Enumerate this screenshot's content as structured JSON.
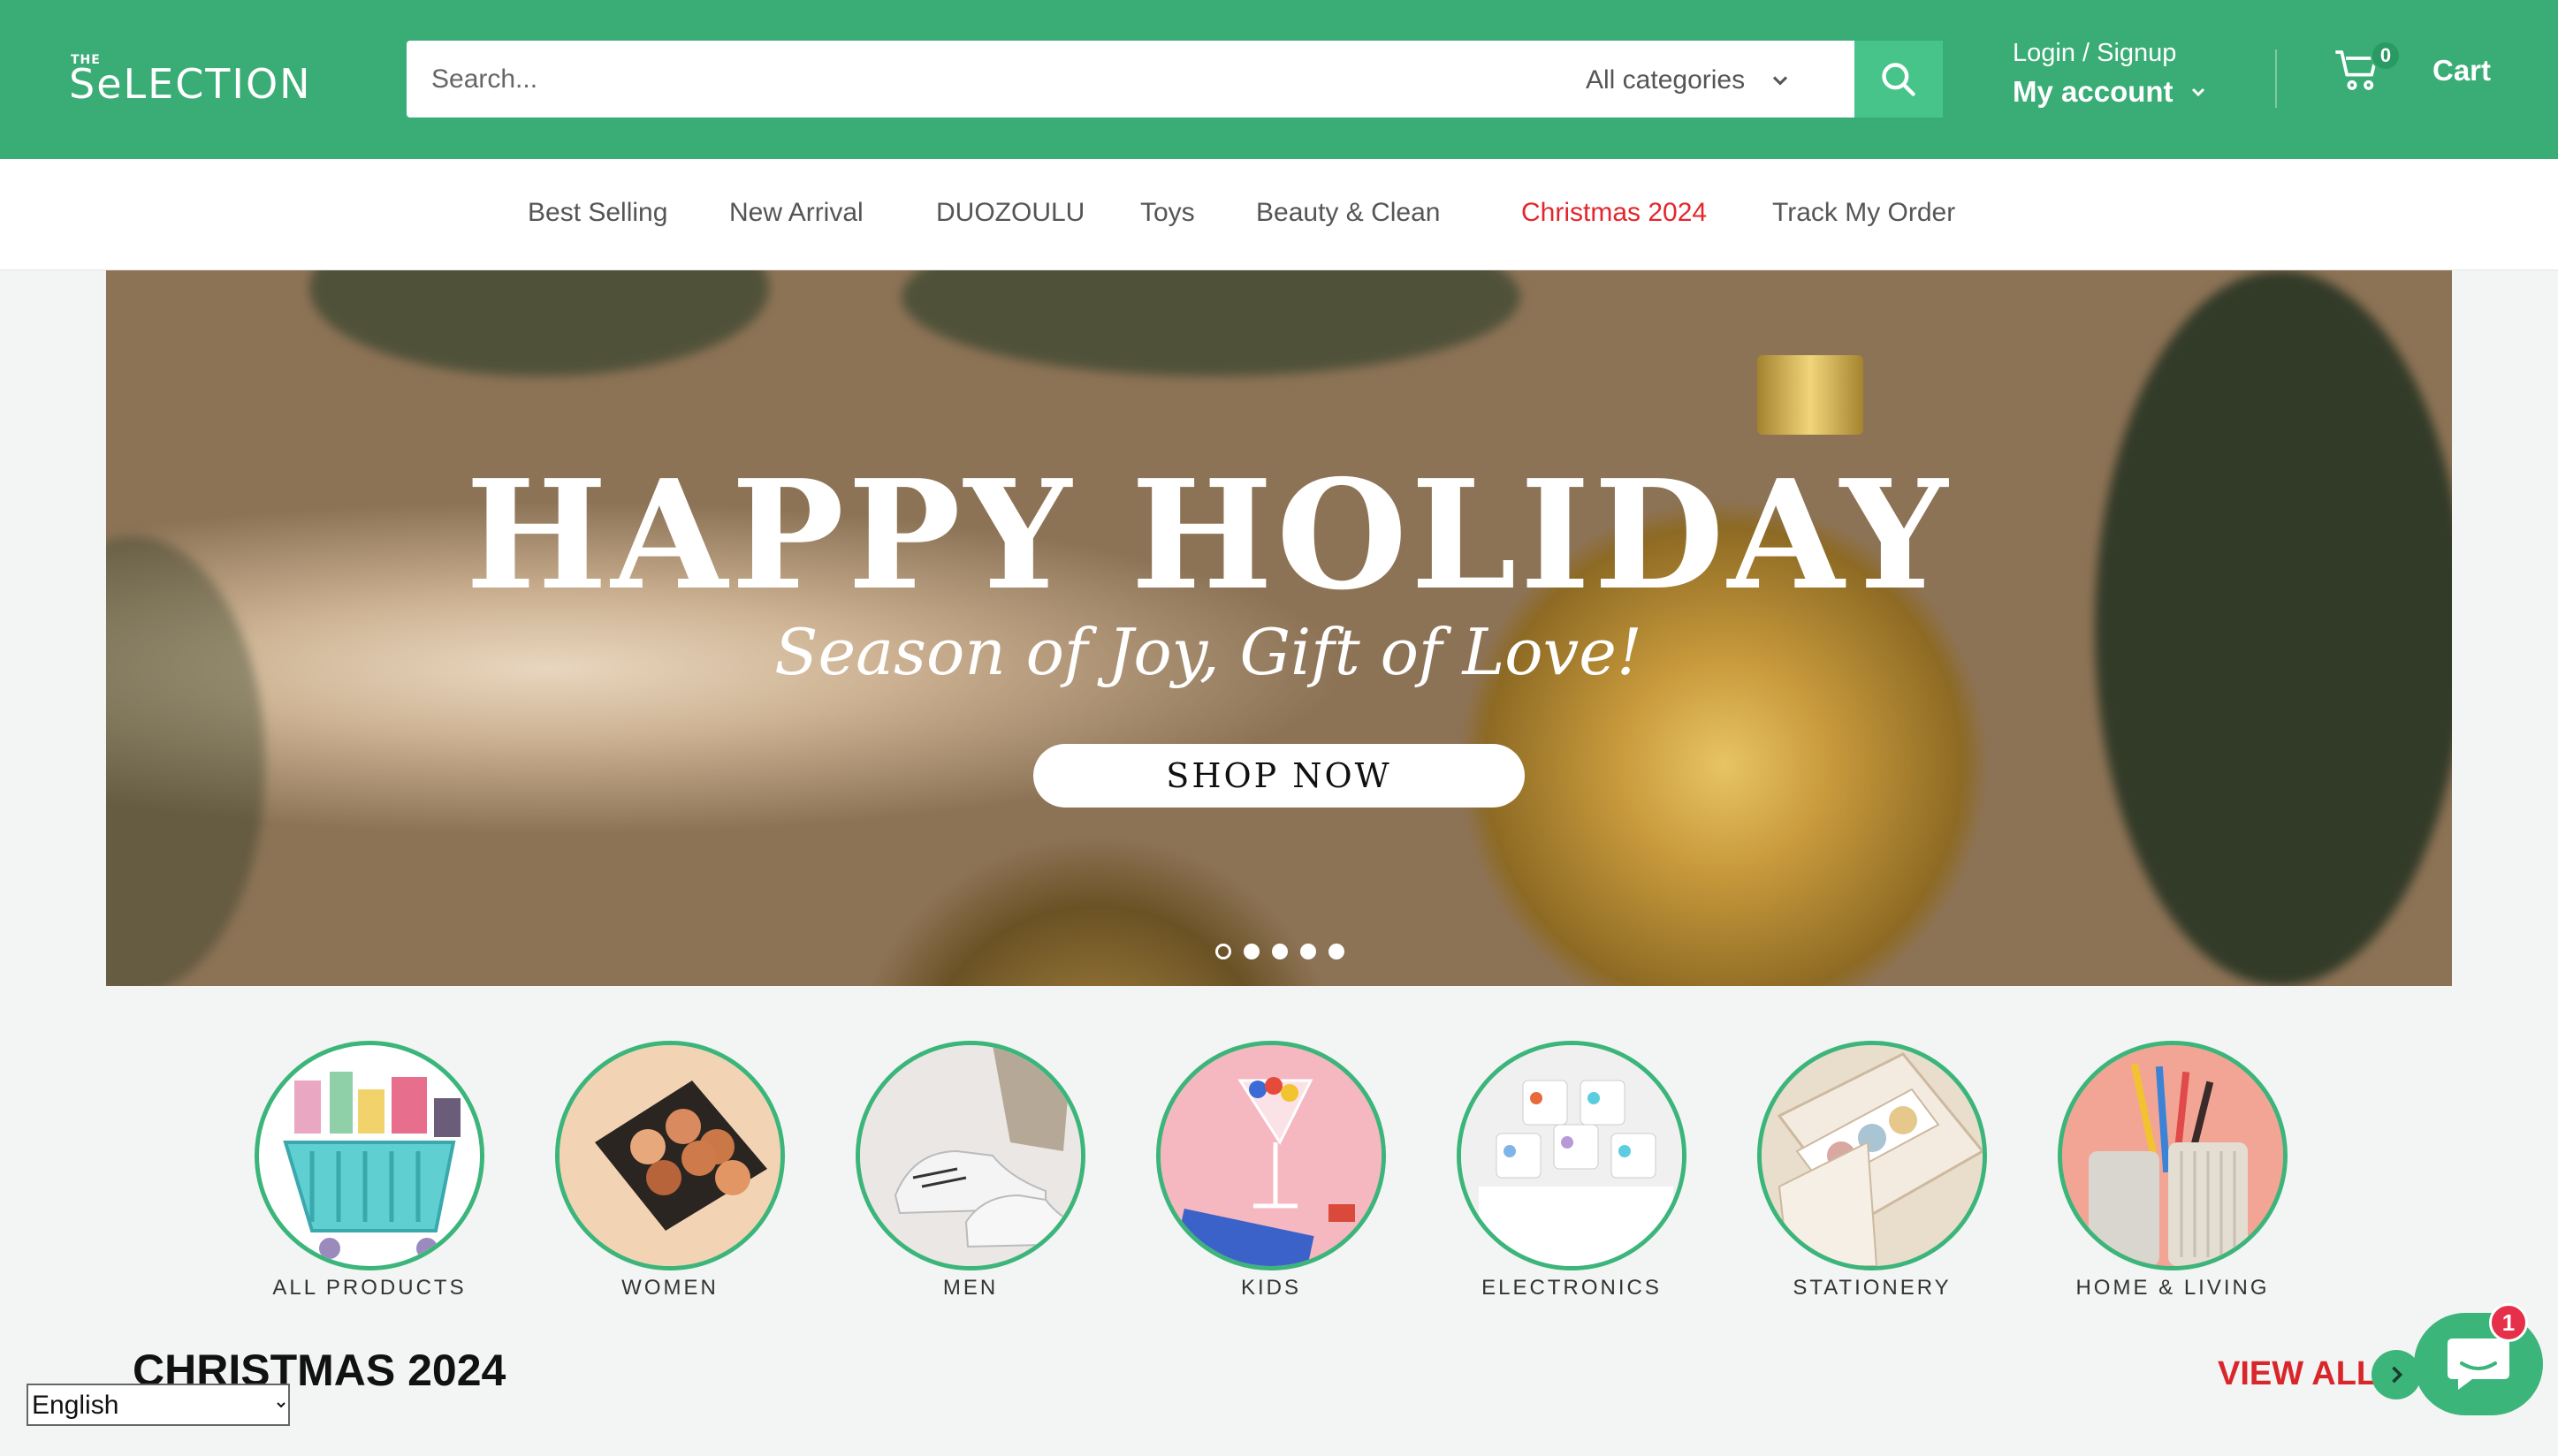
{
  "header": {
    "logo_small": "THE",
    "logo_text": "SeLECTION",
    "search_placeholder": "Search...",
    "category_select": "All categories",
    "login_label": "Login / Signup",
    "account_label": "My account",
    "cart_count": "0",
    "cart_label": "Cart",
    "colors": {
      "brand_green": "#3aac76",
      "search_button": "#47c48a"
    }
  },
  "nav": {
    "items": [
      {
        "label": "Best Selling"
      },
      {
        "label": "New Arrival"
      },
      {
        "label": "DUOZOULU"
      },
      {
        "label": "Toys"
      },
      {
        "label": "Beauty & Clean"
      },
      {
        "label": "Christmas 2024",
        "color": "#e3262c"
      },
      {
        "label": "Track My Order"
      }
    ]
  },
  "hero": {
    "title": "HAPPY HOLIDAY",
    "subtitle": "Season of Joy, Gift of Love!",
    "button": "SHOP NOW",
    "slides_count": 5,
    "active_slide": 1
  },
  "categories": [
    {
      "label": "ALL PRODUCTS",
      "icon": "shopping-basket-image"
    },
    {
      "label": "WOMEN",
      "icon": "eyeshadow-palette-image"
    },
    {
      "label": "MEN",
      "icon": "sneakers-image"
    },
    {
      "label": "KIDS",
      "icon": "toys-glass-image"
    },
    {
      "label": "ELECTRONICS",
      "icon": "earphones-image"
    },
    {
      "label": "STATIONERY",
      "icon": "washi-tape-image"
    },
    {
      "label": "HOME & LIVING",
      "icon": "toothbrush-cup-image"
    }
  ],
  "section": {
    "title": "CHRISTMAS 2024",
    "view_all": "VIEW ALL"
  },
  "language": {
    "selected": "English"
  },
  "chat": {
    "badge": "1"
  }
}
